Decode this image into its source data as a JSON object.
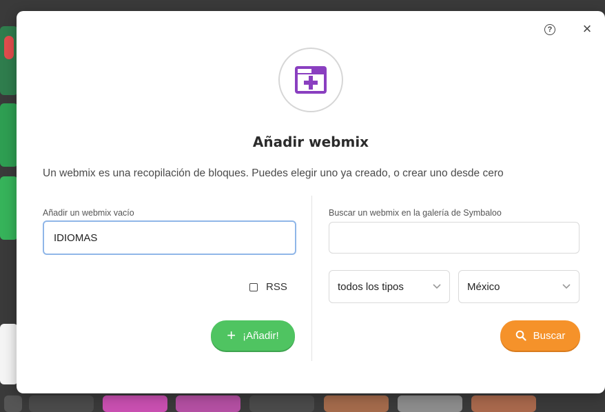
{
  "modal": {
    "title": "Añadir webmix",
    "description": "Un webmix es una recopilación de bloques. Puedes elegir uno ya creado, o crear uno desde cero",
    "help_glyph": "?",
    "close_glyph": "×"
  },
  "left": {
    "label": "Añadir un webmix vacío",
    "name_value": "IDIOMAS",
    "rss_label": "RSS",
    "rss_checked": false,
    "add_button": "¡Añadir!",
    "add_glyph": "+"
  },
  "right": {
    "label": "Buscar un webmix en la galería de Symbaloo",
    "search_value": "",
    "type_selected": "todos los tipos",
    "country_selected": "México",
    "search_button": "Buscar"
  },
  "colors": {
    "accent_purple": "#8a3fc0",
    "add_green": "#4fc461",
    "search_orange": "#f5922a"
  },
  "icons": [
    "add-webmix-icon",
    "help-icon",
    "close-icon",
    "plus-icon",
    "search-icon",
    "chevron-down-icon"
  ]
}
